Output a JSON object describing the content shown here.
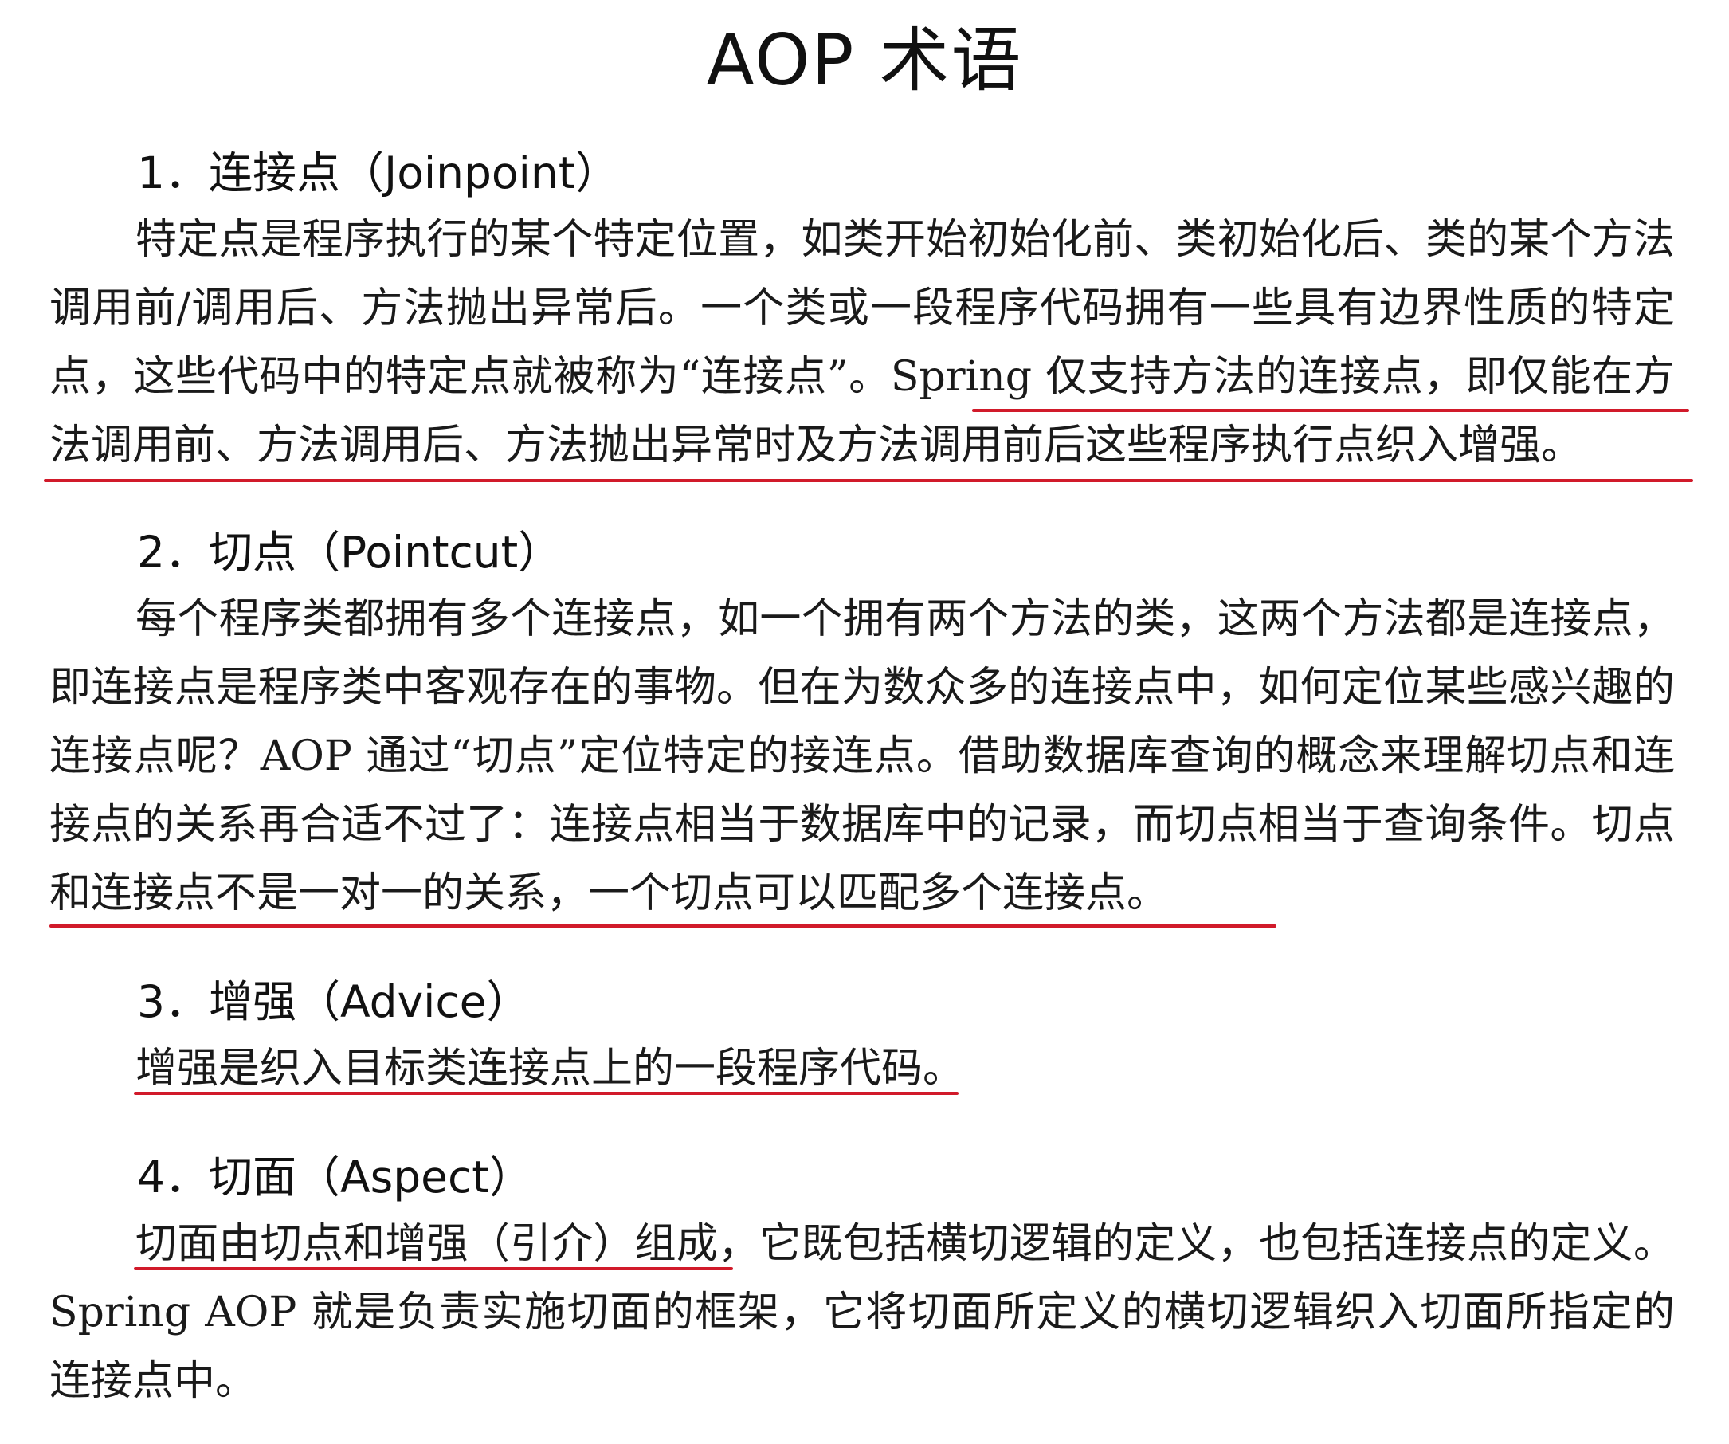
{
  "page": {
    "title": "AOP 术语"
  },
  "sections": [
    {
      "heading": "1．连接点（Joinpoint）",
      "body": "特定点是程序执行的某个特定位置，如类开始初始化前、类初始化后、类的某个方法调用前/调用后、方法抛出异常后。一个类或一段程序代码拥有一些具有边界性质的特定点，这些代码中的特定点就被称为“连接点”。Spring 仅支持方法的连接点，即仅能在方法调用前、方法调用后、方法抛出异常时及方法调用前后这些程序执行点织入增强。"
    },
    {
      "heading": "2．切点（Pointcut）",
      "body": "每个程序类都拥有多个连接点，如一个拥有两个方法的类，这两个方法都是连接点，即连接点是程序类中客观存在的事物。但在为数众多的连接点中，如何定位某些感兴趣的连接点呢？AOP 通过“切点”定位特定的接连点。借助数据库查询的概念来理解切点和连接点的关系再合适不过了：连接点相当于数据库中的记录，而切点相当于查询条件。切点和连接点不是一对一的关系，一个切点可以匹配多个连接点。"
    },
    {
      "heading": "3．增强（Advice）",
      "body": "增强是织入目标类连接点上的一段程序代码。"
    },
    {
      "heading": "4．切面（Aspect）",
      "body": "切面由切点和增强（引介）组成，它既包括横切逻辑的定义，也包括连接点的定义。Spring AOP 就是负责实施切面的框架，它将切面所定义的横切逻辑织入切面所指定的连接点中。"
    }
  ],
  "colors": {
    "underline": "#d11a2a",
    "text": "#1a1a1a"
  }
}
